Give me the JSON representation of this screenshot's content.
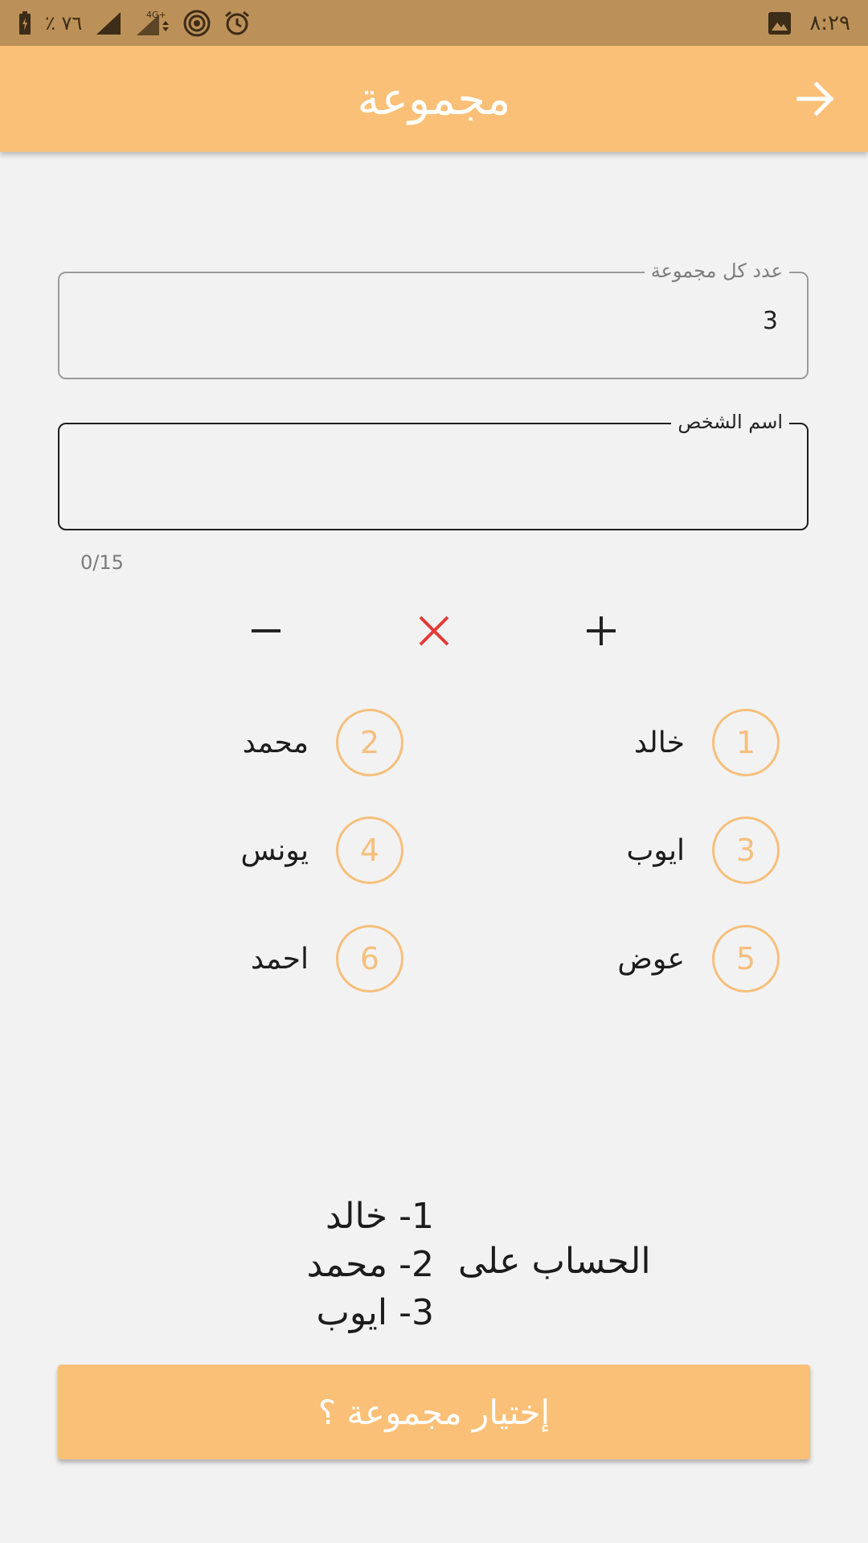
{
  "status_bar": {
    "battery_text": "٪ ٧٦",
    "time": "٨:٢٩",
    "network": "4G+",
    "icons": [
      "battery-icon",
      "signal-icon",
      "signal-4g-icon",
      "hotspot-icon",
      "alarm-icon",
      "image-notification-icon"
    ]
  },
  "app_bar": {
    "title": "مجموعة",
    "back_icon": "arrow-right-icon"
  },
  "fields": {
    "count_label": "عدد كل مجموعة",
    "count_value": "3",
    "name_label": "اسم الشخص",
    "name_value": "",
    "name_counter": "0/15"
  },
  "actions": {
    "remove_icon": "minus-icon",
    "clear_icon": "close-icon",
    "add_icon": "plus-icon",
    "clear_color": "#e53935"
  },
  "people": [
    {
      "number": "1",
      "name": "خالد"
    },
    {
      "number": "2",
      "name": "محمد"
    },
    {
      "number": "3",
      "name": "ايوب"
    },
    {
      "number": "4",
      "name": "يونس"
    },
    {
      "number": "5",
      "name": "عوض"
    },
    {
      "number": "6",
      "name": "احمد"
    }
  ],
  "result": {
    "label": "الحساب على",
    "lines": [
      "1- خالد",
      "2- محمد",
      "3- ايوب"
    ]
  },
  "choose_button": "إختيار مجموعة ؟",
  "colors": {
    "accent": "#fac077",
    "status_bar": "#bc9159",
    "circle": "#f6bf7b",
    "background": "#f2f2f2"
  }
}
